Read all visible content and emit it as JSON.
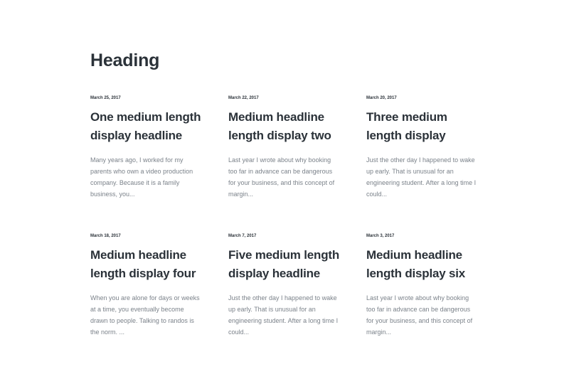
{
  "heading": "Heading",
  "posts": [
    {
      "date": "March 25, 2017",
      "title": "One medium length display headline",
      "excerpt": "Many years ago, I worked for my parents who own a video production company. Because it is a family business, you..."
    },
    {
      "date": "March 22, 2017",
      "title": "Medium headline length display two",
      "excerpt": "Last year I wrote about why booking too far in advance can be dangerous for your business, and this concept of margin..."
    },
    {
      "date": "March 20, 2017",
      "title": "Three medium length display",
      "excerpt": "Just the other day I happened to wake up early. That is unusual for an engineering student. After a long time I could..."
    },
    {
      "date": "March 18, 2017",
      "title": "Medium headline length display four",
      "excerpt": "When you are alone for days or weeks at a time, you eventually become drawn to people. Talking to randos is the norm. ..."
    },
    {
      "date": "March 7, 2017",
      "title": "Five medium length display headline",
      "excerpt": "Just the other day I happened to wake up early. That is unusual for an engineering student. After a long time I could..."
    },
    {
      "date": "March 3, 2017",
      "title": "Medium headline length display six",
      "excerpt": "Last year I wrote about why booking too far in advance can be dangerous for your business, and this concept of margin..."
    }
  ]
}
